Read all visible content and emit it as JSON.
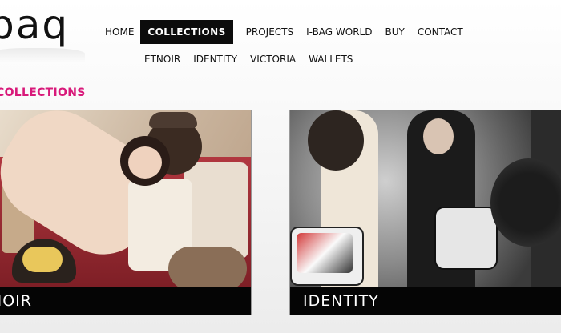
{
  "logo": {
    "text": "baq"
  },
  "nav": {
    "items": [
      {
        "label": "HOME",
        "active": false
      },
      {
        "label": "COLLECTIONS",
        "active": true
      },
      {
        "label": "PROJECTS",
        "active": false
      },
      {
        "label": "I-BAG WORLD",
        "active": false
      },
      {
        "label": "BUY",
        "active": false
      },
      {
        "label": "CONTACT",
        "active": false
      }
    ]
  },
  "subnav": {
    "items": [
      {
        "label": "ETNOIR"
      },
      {
        "label": "IDENTITY"
      },
      {
        "label": "VICTORIA"
      },
      {
        "label": "WALLETS"
      }
    ]
  },
  "section": {
    "title": "COLLECTIONS"
  },
  "collections": [
    {
      "caption": "NOIR"
    },
    {
      "caption": "IDENTITY"
    }
  ],
  "colors": {
    "accent": "#d8197a",
    "nav_active_bg": "#0c0c0c",
    "caption_bg": "#050505"
  }
}
